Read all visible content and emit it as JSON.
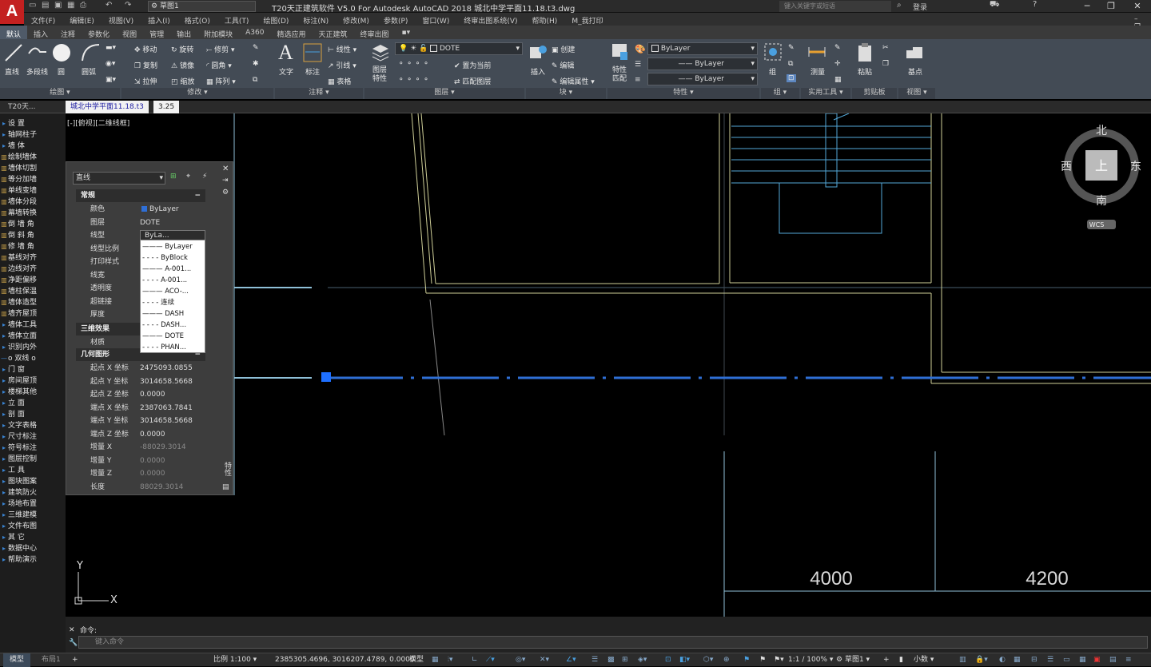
{
  "app": {
    "logo": "A",
    "workspace": "草图1",
    "title": "T20天正建筑软件 V5.0 For Autodesk AutoCAD 2018    城北中学平面11.18.t3.dwg",
    "search_placeholder": "键入关键字或短语",
    "user": "登录"
  },
  "menu": [
    "文件(F)",
    "编辑(E)",
    "视图(V)",
    "插入(I)",
    "格式(O)",
    "工具(T)",
    "绘图(D)",
    "标注(N)",
    "修改(M)",
    "参数(P)",
    "窗口(W)",
    "终审出图系统(V)",
    "帮助(H)",
    "M_我打印"
  ],
  "ribbon_tabs": [
    "默认",
    "插入",
    "注释",
    "参数化",
    "视图",
    "管理",
    "输出",
    "附加模块",
    "A360",
    "精选应用",
    "天正建筑",
    "终审出图"
  ],
  "ribbon": {
    "draw": {
      "title": "绘图",
      "line": "直线",
      "pline": "多段线",
      "circle": "圆",
      "arc": "圆弧"
    },
    "modify": {
      "title": "修改",
      "move": "移动",
      "rotate": "旋转",
      "trim": "修剪",
      "copy": "复制",
      "mirror": "镜像",
      "fillet": "圆角",
      "stretch": "拉伸",
      "scale": "缩放",
      "array": "阵列"
    },
    "annotation": {
      "title": "注释",
      "text": "文字",
      "dim": "标注",
      "linear": "线性",
      "leader": "引线",
      "table": "表格"
    },
    "layers": {
      "title": "图层",
      "props": "图层特性",
      "current_layer": "DOTE",
      "set_current": "置为当前",
      "match": "匹配图层"
    },
    "block": {
      "title": "块",
      "insert": "插入",
      "create": "创建",
      "edit": "编辑",
      "attr": "编辑属性"
    },
    "properties": {
      "title": "特性",
      "match": "特性匹配",
      "color": "ByLayer",
      "linetype": "ByLayer",
      "lineweight": "ByLayer"
    },
    "groups": {
      "title": "组",
      "group": "组"
    },
    "utilities": {
      "title": "实用工具",
      "measure": "测量"
    },
    "clipboard": {
      "title": "剪贴板",
      "paste": "粘贴"
    },
    "view": {
      "title": "视图",
      "base": "基点"
    }
  },
  "doc_tabs": [
    "T20天...",
    "城北中学平面11.18.t3",
    "3.25"
  ],
  "view_label": "[-][俯视][二维线框]",
  "left_menu": [
    {
      "t": "设    置",
      "a": true
    },
    {
      "t": "轴网柱子",
      "a": true
    },
    {
      "t": "墙    体",
      "a": true
    },
    {
      "t": "绘制墙体",
      "i": true
    },
    {
      "t": "墙体切割",
      "i": true
    },
    {
      "t": "等分加墙",
      "i": true
    },
    {
      "t": "单线变墙",
      "i": true
    },
    {
      "t": "墙体分段",
      "i": true
    },
    {
      "t": "幕墙转换",
      "i": true
    },
    {
      "t": "倒 墙 角",
      "i": true
    },
    {
      "t": "倒 斜 角",
      "i": true
    },
    {
      "t": "修 墙 角",
      "i": true
    },
    {
      "t": "基线对齐",
      "i": true
    },
    {
      "t": "边线对齐",
      "i": true
    },
    {
      "t": "净距偏移",
      "i": true
    },
    {
      "t": "墙柱保温",
      "i": true
    },
    {
      "t": "墙体造型",
      "i": true
    },
    {
      "t": "墙齐屋顶",
      "i": true
    },
    {
      "t": "墙体工具",
      "a": true
    },
    {
      "t": "墙体立面",
      "a": true
    },
    {
      "t": "识别内外",
      "a": true
    },
    {
      "t": "o 双线 o",
      "a": false
    },
    {
      "t": "门    窗",
      "a": true
    },
    {
      "t": "房间屋顶",
      "a": true
    },
    {
      "t": "楼梯其他",
      "a": true
    },
    {
      "t": "立    面",
      "a": true
    },
    {
      "t": "剖    面",
      "a": true
    },
    {
      "t": "文字表格",
      "a": true
    },
    {
      "t": "尺寸标注",
      "a": true
    },
    {
      "t": "符号标注",
      "a": true
    },
    {
      "t": "图层控制",
      "a": true
    },
    {
      "t": "工    具",
      "a": true
    },
    {
      "t": "图块图案",
      "a": true
    },
    {
      "t": "建筑防火",
      "a": true
    },
    {
      "t": "场地布置",
      "a": true
    },
    {
      "t": "三维建模",
      "a": true
    },
    {
      "t": "文件布图",
      "a": true
    },
    {
      "t": "其    它",
      "a": true
    },
    {
      "t": "数据中心",
      "a": true
    },
    {
      "t": "帮助演示",
      "a": true
    }
  ],
  "properties_palette": {
    "object_type": "直线",
    "general_title": "常规",
    "general": [
      {
        "k": "颜色",
        "v": "ByLayer"
      },
      {
        "k": "图层",
        "v": "DOTE"
      },
      {
        "k": "线型",
        "v": "ByLa..."
      },
      {
        "k": "线型比例",
        "v": ""
      },
      {
        "k": "打印样式",
        "v": ""
      },
      {
        "k": "线宽",
        "v": ""
      },
      {
        "k": "透明度",
        "v": ""
      },
      {
        "k": "超链接",
        "v": ""
      },
      {
        "k": "厚度",
        "v": ""
      }
    ],
    "three_d_title": "三维效果",
    "three_d": [
      {
        "k": "材质",
        "v": ""
      }
    ],
    "geometry_title": "几何图形",
    "geometry": [
      {
        "k": "起点 X 坐标",
        "v": "2475093.0855"
      },
      {
        "k": "起点 Y 坐标",
        "v": "3014658.5668"
      },
      {
        "k": "起点 Z 坐标",
        "v": "0.0000"
      },
      {
        "k": "端点 X 坐标",
        "v": "2387063.7841"
      },
      {
        "k": "端点 Y 坐标",
        "v": "3014658.5668"
      },
      {
        "k": "端点 Z 坐标",
        "v": "0.0000"
      },
      {
        "k": "增量 X",
        "v": "-88029.3014"
      },
      {
        "k": "增量 Y",
        "v": "0.0000"
      },
      {
        "k": "增量 Z",
        "v": "0.0000"
      },
      {
        "k": "长度",
        "v": "88029.3014"
      }
    ],
    "side_label": "特性"
  },
  "linetype_list": [
    "ByLayer",
    "ByBlock",
    "A-001...",
    "A-001...",
    "ACO-...",
    "连续",
    "DASH",
    "DASH...",
    "DOTE",
    "PHAN..."
  ],
  "viewcube": {
    "n": "北",
    "s": "南",
    "e": "东",
    "w": "西",
    "top": "上",
    "wcs": "WCS"
  },
  "dims": [
    "4000",
    "4200"
  ],
  "ucs": {
    "x": "X",
    "y": "Y"
  },
  "command": {
    "label": "命令:",
    "placeholder": "键入命令"
  },
  "status": {
    "model_tab": "模型",
    "layout_tab": "布局1",
    "scale": "比例 1:100",
    "coords": "2385305.4696, 3016207.4789, 0.0000",
    "model": "模型",
    "anno_scale": "1:1 / 100%",
    "workspace": "草图1",
    "units": "小数"
  },
  "colors": {
    "bg": "#000000",
    "wall": "#d7d7a8",
    "cyan": "#53a8d8",
    "selected": "#2f6fd6",
    "grip": "#1e6fff"
  }
}
